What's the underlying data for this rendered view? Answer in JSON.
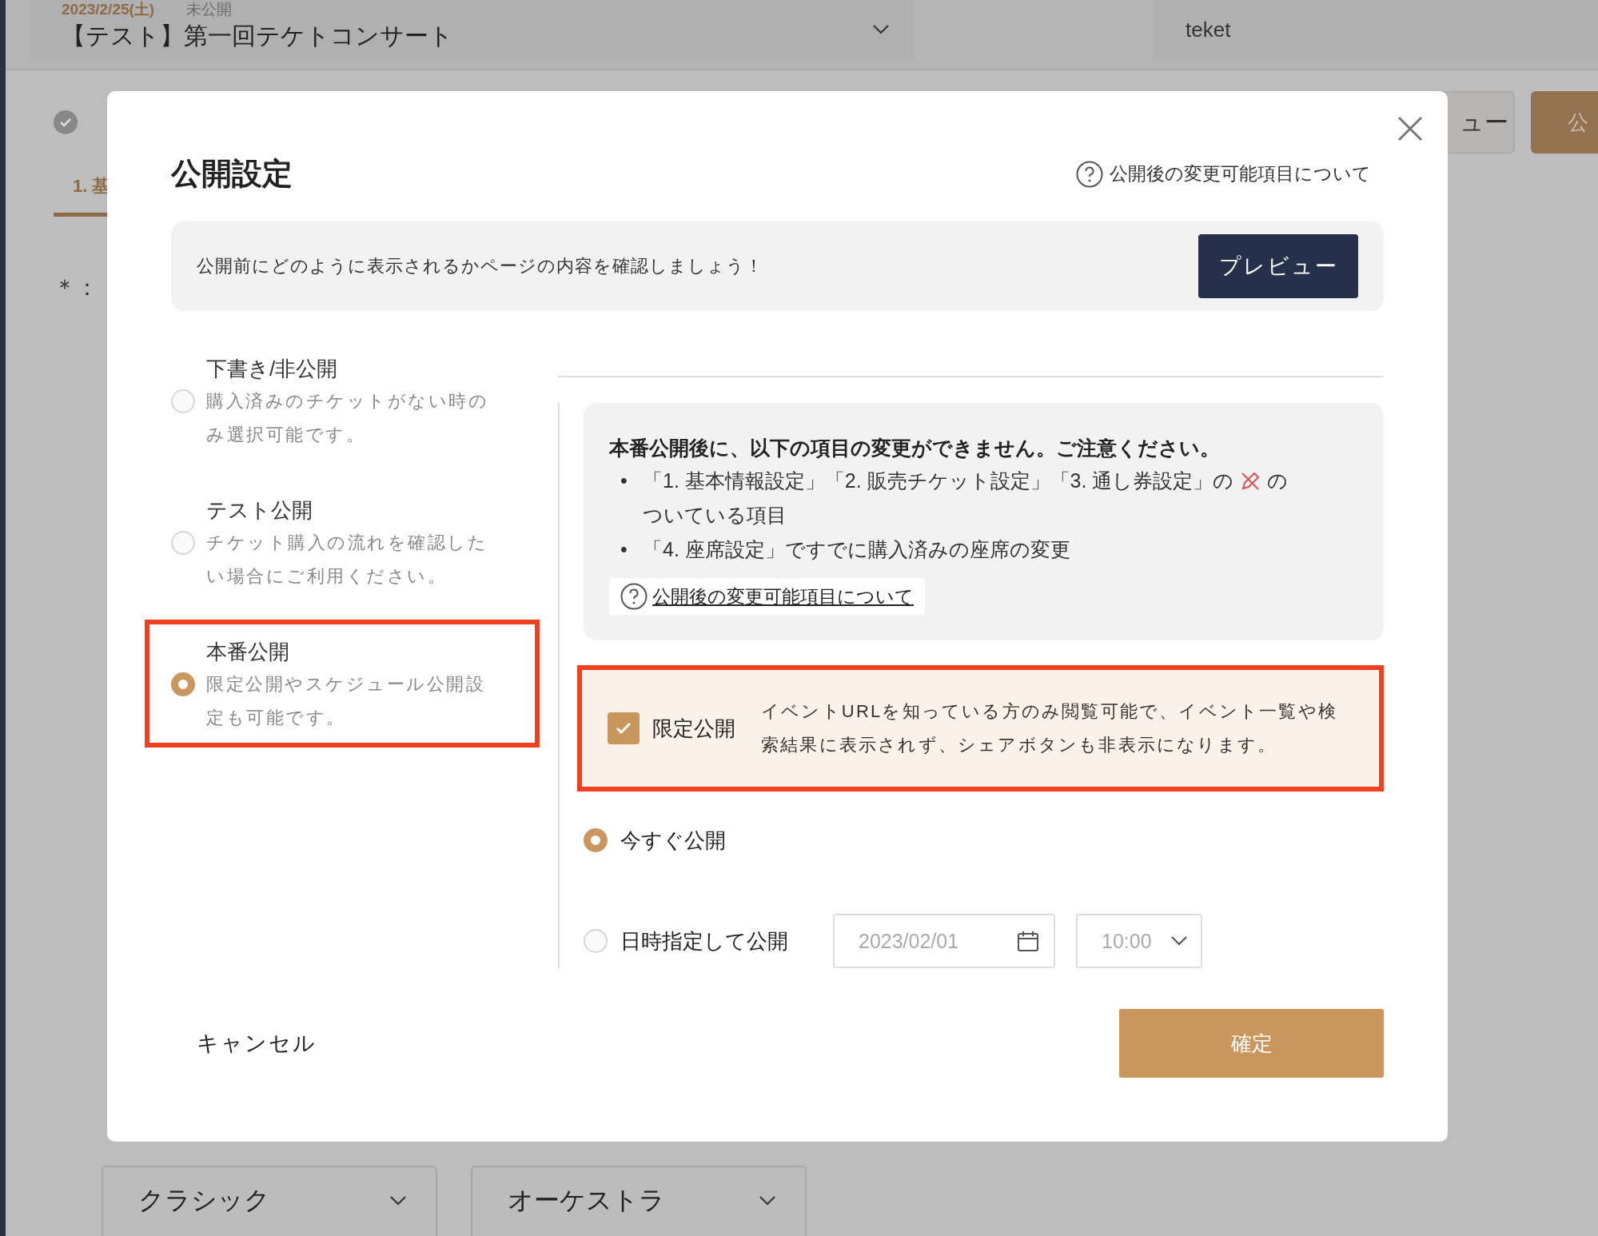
{
  "background": {
    "event_select": {
      "date": "2023/2/25(土)",
      "status": "未公開",
      "title": "【テスト】第一回テケトコンサート"
    },
    "account_field": "teket",
    "preview_button": "ュー",
    "publish_button": "公",
    "step_tab": "1. 基",
    "required_note": "＊：",
    "selects": [
      "クラシック",
      "オーケストラ"
    ]
  },
  "modal": {
    "title": "公開設定",
    "help_link": "公開後の変更可能項目について",
    "preview_box": {
      "text": "公開前にどのように表示されるかページの内容を確認しましょう！",
      "button": "プレビュー"
    },
    "options": [
      {
        "title": "下書き/非公開",
        "description": "購入済みのチケットがない時のみ選択可能です。",
        "selected": false,
        "highlighted": false
      },
      {
        "title": "テスト公開",
        "description": "チケット購入の流れを確認したい場合にご利用ください。",
        "selected": false,
        "highlighted": false
      },
      {
        "title": "本番公開",
        "description": "限定公開やスケジュール公開設定も可能です。",
        "selected": true,
        "highlighted": true
      }
    ],
    "notice": {
      "heading": "本番公開後に、以下の項目の変更ができません。ご注意ください。",
      "bullets": [
        {
          "marker": "•",
          "before": "「1. 基本情報設定」「2. 販売チケット設定」「3. 通し券設定」の",
          "after": "の",
          "continued": "ついている項目"
        },
        {
          "marker": "•",
          "before": "「4. 座席設定」ですでに購入済みの座席の変更"
        }
      ],
      "link": "公開後の変更可能項目について"
    },
    "limited": {
      "label": "限定公開",
      "description": "イベントURLを知っている方のみ閲覧可能で、イベント一覧や検索結果に表示されず、シェアボタンも非表示になります。",
      "checked": true,
      "highlighted": true
    },
    "schedule": [
      {
        "kind": "now",
        "label": "今すぐ公開",
        "selected": true
      },
      {
        "kind": "datetime",
        "label": "日時指定して公開",
        "selected": false,
        "date": "2023/02/01",
        "time": "10:00"
      }
    ],
    "cancel": "キャンセル",
    "confirm": "確定"
  }
}
